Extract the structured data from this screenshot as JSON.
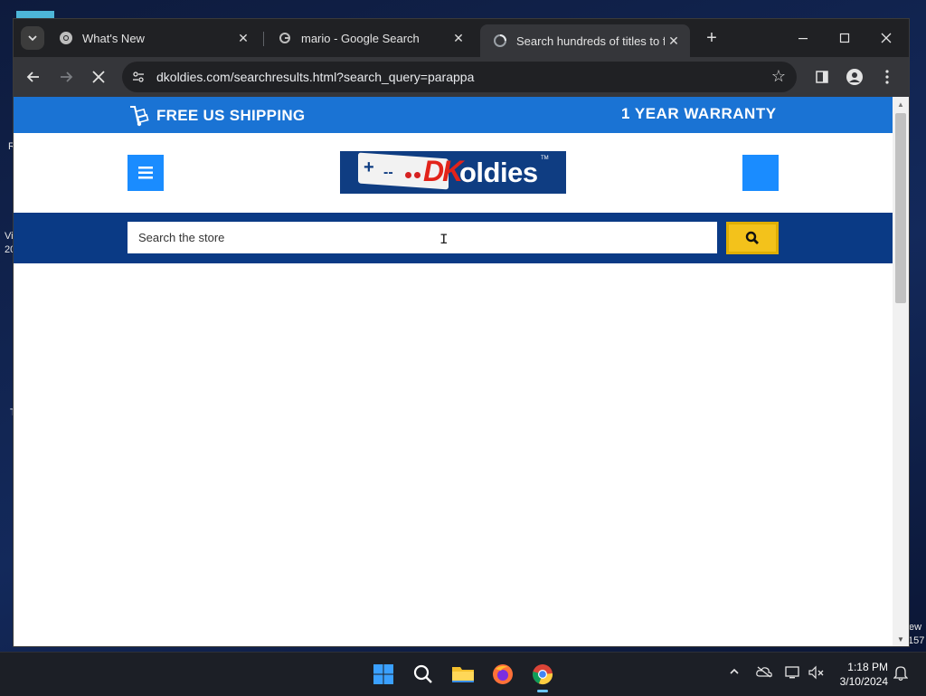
{
  "desktop": {
    "fragments": [
      "R",
      "Vi",
      "20",
      "T",
      "ew",
      "157"
    ]
  },
  "browser": {
    "tabs": [
      {
        "title": "What's New",
        "icon": "chrome-icon",
        "active": false
      },
      {
        "title": "mario - Google Search",
        "icon": "google-icon",
        "active": false
      },
      {
        "title": "Search hundreds of titles to find",
        "icon": "loading-globe-icon",
        "active": true
      }
    ],
    "address": {
      "url": "dkoldies.com/searchresults.html?search_query=parappa"
    }
  },
  "page": {
    "promo": {
      "shipping": "FREE US SHIPPING",
      "warranty": "1 YEAR WARRANTY"
    },
    "logo": {
      "plus": "+",
      "dashes": "--",
      "dk": "DK",
      "oldies": "oldies",
      "tm": "TM"
    },
    "search": {
      "placeholder": "Search the store",
      "value": ""
    },
    "colors": {
      "promo_bar": "#1a73d4",
      "search_bar": "#0a3a85",
      "button_blue": "#1a8cff",
      "search_button": "#f3c21b"
    }
  },
  "taskbar": {
    "apps": [
      "windows-start-icon",
      "search-icon",
      "file-explorer-icon",
      "firefox-icon",
      "chrome-icon"
    ],
    "time": "1:18 PM",
    "date": "3/10/2024"
  }
}
